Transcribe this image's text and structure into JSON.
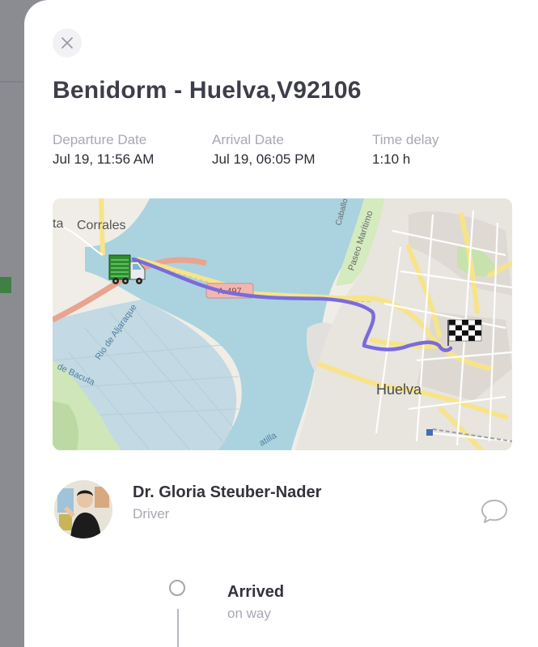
{
  "shipment": {
    "title": "Benidorm - Huelva,V92106",
    "departure": {
      "label": "Departure Date",
      "value": "Jul 19, 11:56 AM"
    },
    "arrival": {
      "label": "Arrival Date",
      "value": "Jul 19, 06:05 PM"
    },
    "delay": {
      "label": "Time delay",
      "value": "1:10 h"
    }
  },
  "map": {
    "labels": {
      "corrales": "Corrales",
      "huelva": "Huelva",
      "road": "A-497",
      "rio_aljaraque": "Rio de Aljaraque",
      "paseo": "Paseo Marítimo",
      "ta": "ta",
      "bacuta": "de Bacuta",
      "caballo": "Caballo",
      "patilla": "atilla"
    },
    "route_color": "#7a6bdc",
    "icons": {
      "start": "truck-icon",
      "end": "checkered-flag-icon"
    }
  },
  "driver": {
    "name": "Dr. Gloria Steuber-Nader",
    "role": "Driver"
  },
  "timeline": [
    {
      "title": "Arrived",
      "subtitle": "on way"
    }
  ]
}
